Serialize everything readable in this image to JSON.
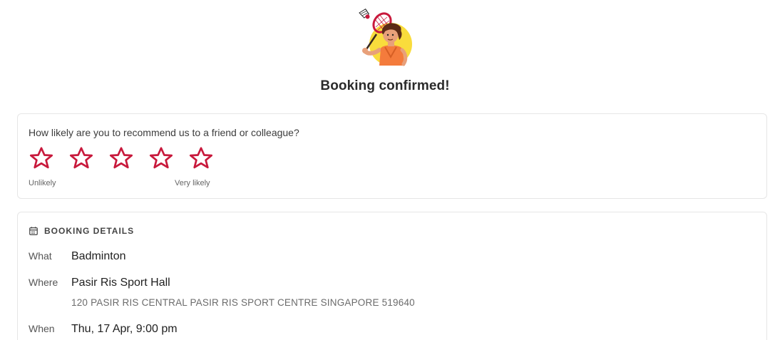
{
  "header": {
    "title": "Booking confirmed!"
  },
  "illustration": {
    "icon": "badminton-player-illustration"
  },
  "rating": {
    "question": "How likely are you to recommend us to a friend or colleague?",
    "star_count": 5,
    "selected": 0,
    "low_label": "Unlikely",
    "high_label": "Very likely",
    "star_color": "#c8193c"
  },
  "details": {
    "header_icon": "calendar-icon",
    "header": "BOOKING DETAILS",
    "what_label": "What",
    "what_value": "Badminton",
    "where_label": "Where",
    "where_value": "Pasir Ris Sport Hall",
    "address": "120 PASIR RIS CENTRAL PASIR RIS SPORT CENTRE SINGAPORE 519640",
    "when_label": "When",
    "when_value": "Thu, 17 Apr, 9:00 pm"
  }
}
